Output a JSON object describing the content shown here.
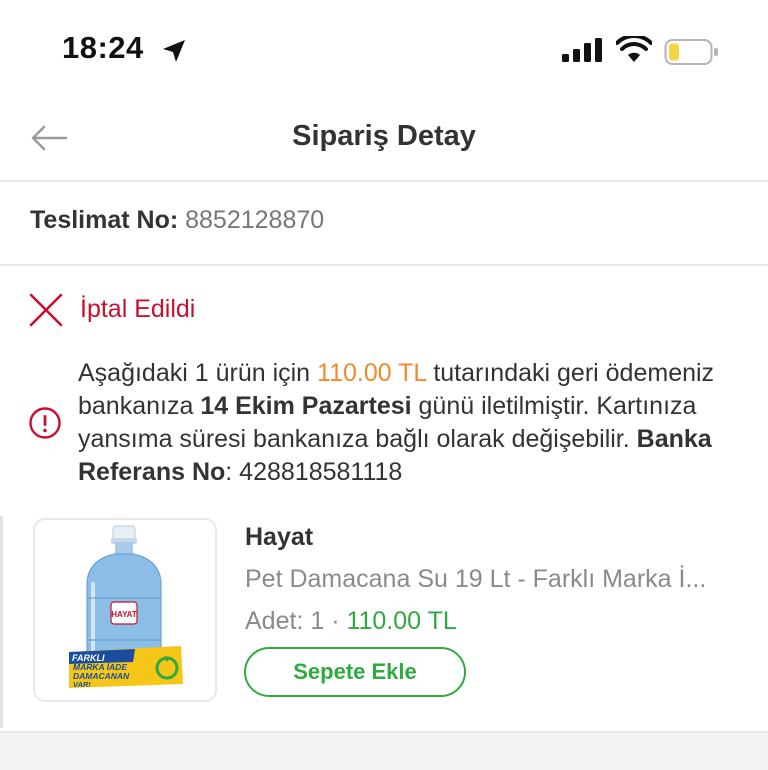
{
  "status_bar": {
    "time": "18:24",
    "icons": [
      "location-arrow-icon",
      "cellular-signal-icon",
      "wifi-icon",
      "battery-icon"
    ]
  },
  "header": {
    "title": "Sipariş Detay",
    "back_icon": "back-arrow-icon"
  },
  "delivery": {
    "label": "Teslimat No:",
    "number": "8852128870"
  },
  "status": {
    "icon": "close-x-icon",
    "label": "İptal Edildi",
    "color": "#c8102e"
  },
  "refund_info": {
    "icon": "info-circle-icon",
    "part1": "Aşağıdaki 1 ürün için ",
    "amount": "110.00 TL",
    "part2": " tutarındaki geri ödemeniz bankanıza ",
    "date": "14 Ekim Pazartesi",
    "part3": " günü iletilmiştir. Kartınıza yansıma süresi bankanıza bağlı olarak değişebilir. ",
    "ref_label": "Banka Referans No",
    "ref_sep": ": ",
    "ref_number": "428818581118",
    "amount_color": "#f08a2c"
  },
  "product": {
    "brand": "Hayat",
    "name": "Pet Damacana Su 19 Lt - Farklı Marka İ...",
    "qty_label": "Adet:",
    "qty_value": "1",
    "separator": "·",
    "price": "110.00 TL",
    "price_color": "#2eaa3f",
    "add_button": "Sepete Ekle",
    "image_brand_text": "HAYAT",
    "image_promo_lines": [
      "FARKLI",
      "MARKA İADE",
      "DAMACANAN",
      "VAR!"
    ]
  }
}
